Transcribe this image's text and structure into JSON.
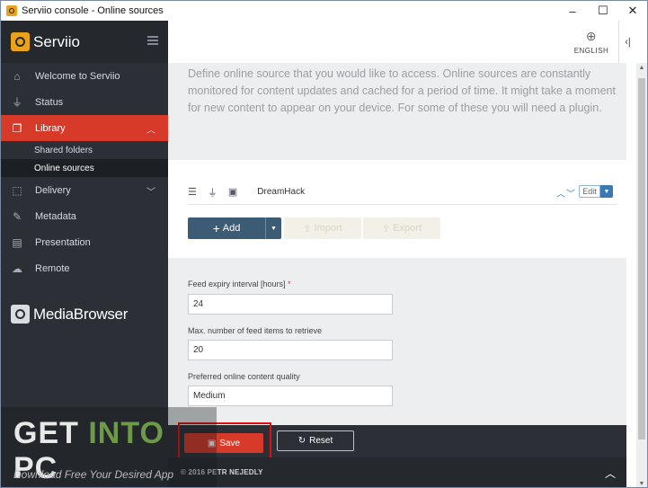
{
  "window": {
    "title": "Serviio console - Online sources",
    "minimize": "–",
    "maximize": "☐",
    "close": "✕"
  },
  "sidebar": {
    "brand": "Serviio",
    "items": [
      {
        "label": "Welcome to Serviio",
        "icon": "home-icon",
        "glyph": "⌂"
      },
      {
        "label": "Status",
        "icon": "plug-icon",
        "glyph": "⏚"
      },
      {
        "label": "Library",
        "icon": "library-icon",
        "glyph": "❐",
        "active": true
      },
      {
        "label": "Delivery",
        "icon": "cube-icon",
        "glyph": "⬚"
      },
      {
        "label": "Metadata",
        "icon": "edit-icon",
        "glyph": "✎"
      },
      {
        "label": "Presentation",
        "icon": "slides-icon",
        "glyph": "▤"
      },
      {
        "label": "Remote",
        "icon": "cloud-icon",
        "glyph": "☁"
      }
    ],
    "library_sub": [
      "Shared folders",
      "Online sources"
    ],
    "mediabrowser": "MediaBrowser"
  },
  "header": {
    "language": "ENGLISH",
    "collapse": "‹|"
  },
  "main": {
    "description": "Define online source that you would like to access. Online sources are constantly monitored for content updates and cached for a period of time. It might take a moment for new content to appear on your device. For some of these you will need a plugin.",
    "source": {
      "name": "DreamHack",
      "edit_label": "Edit"
    },
    "buttons": {
      "add": "Add",
      "import": "Import",
      "export": "Export"
    },
    "form": {
      "feed_expiry_label": "Feed expiry interval [hours]",
      "feed_expiry_value": "24",
      "max_items_label": "Max. number of feed items to retrieve",
      "max_items_value": "20",
      "quality_label": "Preferred online content quality",
      "quality_value": "Medium"
    },
    "save_label": "Save",
    "reset_label": "Reset",
    "footer": "© 2016 PETR NEJEDLY"
  },
  "watermark": {
    "get": "GET ",
    "into": "INTO",
    "pc": " PC",
    "tagline": "Download Free Your Desired App"
  },
  "colors": {
    "accent": "#d83a2a",
    "sidebar": "#2c3036",
    "brand": "#e8a31a",
    "primary_button": "#3c5b74"
  }
}
